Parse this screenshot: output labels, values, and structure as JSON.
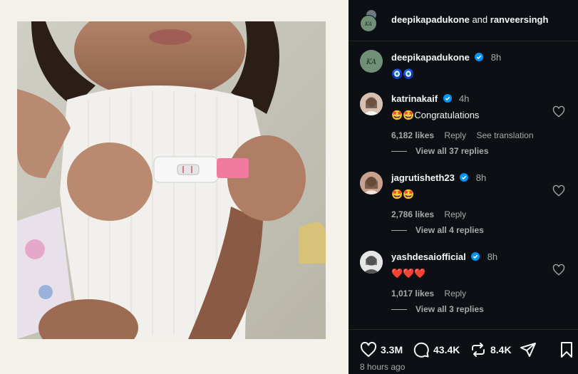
{
  "header": {
    "user1": "deepikapadukone",
    "connector": "and",
    "user2": "ranveersingh",
    "logo_text": "KA"
  },
  "caption": {
    "username": "deepikapadukone",
    "time": "8h",
    "text": "🧿🧿"
  },
  "comments": [
    {
      "username": "katrinakaif",
      "time": "4h",
      "text": "🤩🤩Congratulations",
      "likes": "6,182 likes",
      "reply": "Reply",
      "translate": "See translation",
      "view_replies": "View all 37 replies"
    },
    {
      "username": "jagrutisheth23",
      "time": "8h",
      "text": "🤩🤩",
      "likes": "2,786 likes",
      "reply": "Reply",
      "view_replies": "View all 4 replies"
    },
    {
      "username": "yashdesaiofficial",
      "time": "8h",
      "text": "❤️❤️❤️",
      "likes": "1,017 likes",
      "reply": "Reply",
      "view_replies": "View all 3 replies"
    }
  ],
  "actions": {
    "likes": "3.3M",
    "comments": "43.4K",
    "reposts": "8.4K"
  },
  "time_ago": "8 hours ago",
  "colors": {
    "background": "#0c1014",
    "verified": "#0095f6",
    "muted": "#a8a8a8",
    "photo_frame": "#f3f1ea"
  }
}
